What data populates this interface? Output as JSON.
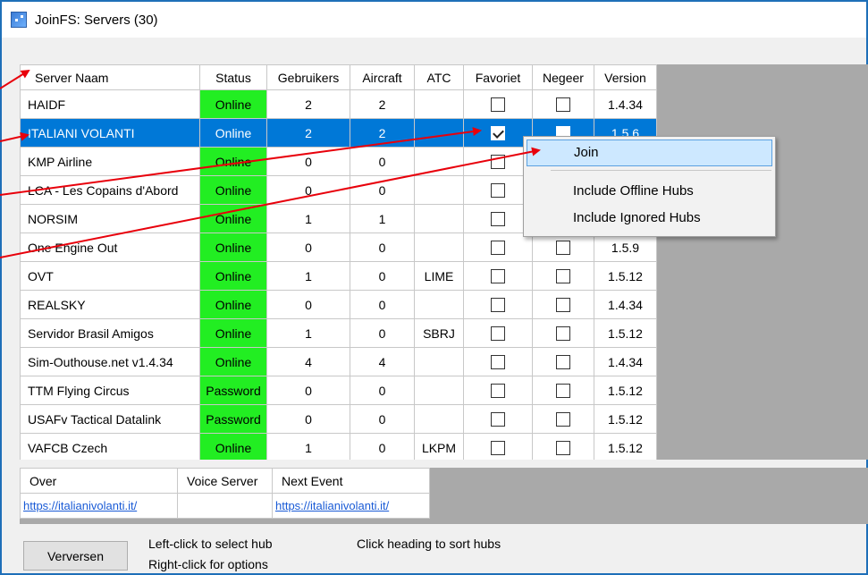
{
  "window": {
    "title": "JoinFS: Servers (30)"
  },
  "grid": {
    "columns": [
      "Server Naam",
      "Status",
      "Gebruikers",
      "Aircraft",
      "ATC",
      "Favoriet",
      "Negeer",
      "Version"
    ],
    "rows": [
      {
        "name": "HAIDF",
        "status": "Online",
        "users": "2",
        "aircraft": "2",
        "atc": "",
        "favoriet": false,
        "negeer": false,
        "version": "1.4.34"
      },
      {
        "name": "ITALIANI VOLANTI",
        "status": "Online",
        "users": "2",
        "aircraft": "2",
        "atc": "",
        "favoriet": true,
        "negeer": false,
        "version": "1.5.6",
        "selected": true
      },
      {
        "name": "KMP Airline",
        "status": "Online",
        "users": "0",
        "aircraft": "0",
        "atc": "",
        "favoriet": false,
        "negeer": false,
        "version": ""
      },
      {
        "name": "LCA - Les Copains d'Abord",
        "status": "Online",
        "users": "0",
        "aircraft": "0",
        "atc": "",
        "favoriet": false,
        "negeer": false,
        "version": ""
      },
      {
        "name": "NORSIM",
        "status": "Online",
        "users": "1",
        "aircraft": "1",
        "atc": "",
        "favoriet": false,
        "negeer": false,
        "version": ""
      },
      {
        "name": "One Engine Out",
        "status": "Online",
        "users": "0",
        "aircraft": "0",
        "atc": "",
        "favoriet": false,
        "negeer": false,
        "version": "1.5.9"
      },
      {
        "name": "OVT",
        "status": "Online",
        "users": "1",
        "aircraft": "0",
        "atc": "LIME",
        "favoriet": false,
        "negeer": false,
        "version": "1.5.12"
      },
      {
        "name": "REALSKY",
        "status": "Online",
        "users": "0",
        "aircraft": "0",
        "atc": "",
        "favoriet": false,
        "negeer": false,
        "version": "1.4.34"
      },
      {
        "name": "Servidor Brasil Amigos",
        "status": "Online",
        "users": "1",
        "aircraft": "0",
        "atc": "SBRJ",
        "favoriet": false,
        "negeer": false,
        "version": "1.5.12"
      },
      {
        "name": "Sim-Outhouse.net v1.4.34",
        "status": "Online",
        "users": "4",
        "aircraft": "4",
        "atc": "",
        "favoriet": false,
        "negeer": false,
        "version": "1.4.34"
      },
      {
        "name": "TTM Flying Circus",
        "status": "Password",
        "users": "0",
        "aircraft": "0",
        "atc": "",
        "favoriet": false,
        "negeer": false,
        "version": "1.5.12"
      },
      {
        "name": "USAFv Tactical Datalink",
        "status": "Password",
        "users": "0",
        "aircraft": "0",
        "atc": "",
        "favoriet": false,
        "negeer": false,
        "version": "1.5.12"
      },
      {
        "name": "VAFCB Czech",
        "status": "Online",
        "users": "1",
        "aircraft": "0",
        "atc": "LKPM",
        "favoriet": false,
        "negeer": false,
        "version": "1.5.12"
      }
    ]
  },
  "context_menu": {
    "items": [
      "Join",
      "Include Offline Hubs",
      "Include Ignored Hubs"
    ]
  },
  "info": {
    "headers": [
      "Over",
      "Voice Server",
      "Next Event"
    ],
    "over_link": "https://italianivolanti.it/",
    "voice_server": "",
    "next_event_link": "https://italianivolanti.it/"
  },
  "footer": {
    "refresh_label": "Verversen",
    "hint_select": "Left-click to select hub",
    "hint_options": "Right-click for options",
    "hint_sort": "Click heading to sort hubs"
  },
  "colors": {
    "status_green": "#22ee22",
    "selection_blue": "#0078d7",
    "annotation_red": "#e8000b",
    "menu_highlight": "#cde8ff"
  }
}
